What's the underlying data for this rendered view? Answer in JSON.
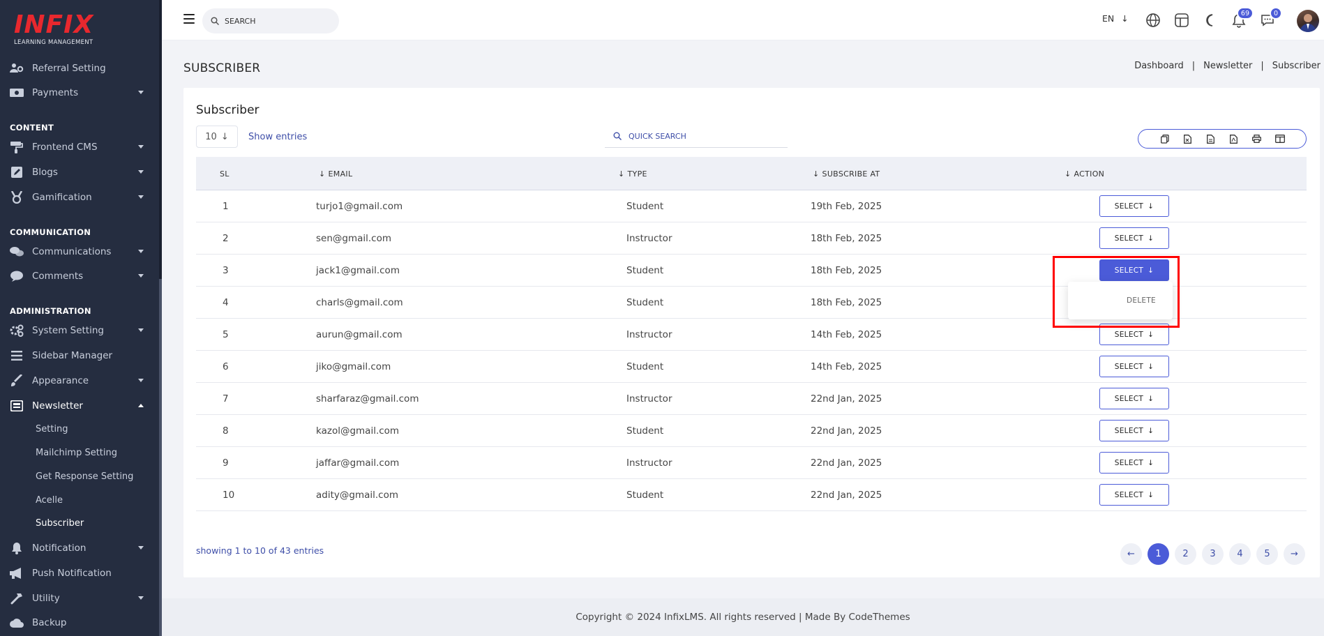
{
  "brand": {
    "logo_word": "INFIX",
    "logo_sub": "LEARNING MANAGEMENT"
  },
  "sidebar": {
    "items_top": [
      {
        "label": "Referral Setting",
        "icon": "users-gear-icon"
      },
      {
        "label": "Payments",
        "icon": "money-icon"
      }
    ],
    "section_content": "CONTENT",
    "items_content": [
      {
        "label": "Frontend CMS",
        "icon": "paint-roller-icon"
      },
      {
        "label": "Blogs",
        "icon": "edit-icon"
      },
      {
        "label": "Gamification",
        "icon": "medal-icon"
      }
    ],
    "section_communication": "COMMUNICATION",
    "items_communication": [
      {
        "label": "Communications",
        "icon": "chat-icon"
      },
      {
        "label": "Comments",
        "icon": "comment-icon"
      }
    ],
    "section_administration": "ADMINISTRATION",
    "items_admin": [
      {
        "label": "System Setting",
        "icon": "gears-icon"
      },
      {
        "label": "Sidebar Manager",
        "icon": "list-icon"
      },
      {
        "label": "Appearance",
        "icon": "brush-icon"
      },
      {
        "label": "Newsletter",
        "icon": "newspaper-icon"
      }
    ],
    "newsletter_sub": [
      "Setting",
      "Mailchimp Setting",
      "Get Response Setting",
      "Acelle",
      "Subscriber"
    ],
    "items_bottom": [
      {
        "label": "Notification",
        "icon": "bell-icon"
      },
      {
        "label": "Push Notification",
        "icon": "megaphone-icon"
      },
      {
        "label": "Utility",
        "icon": "hammer-icon"
      },
      {
        "label": "Backup",
        "icon": "cloud-icon"
      }
    ]
  },
  "topbar": {
    "search_placeholder": "SEARCH",
    "language": "EN",
    "notifications_count": "69",
    "messages_count": "0"
  },
  "page": {
    "title": "SUBSCRIBER",
    "breadcrumb": [
      "Dashboard",
      "Newsletter",
      "Subscriber"
    ]
  },
  "card": {
    "title": "Subscriber",
    "entries_value": "10",
    "entries_label": "Show entries",
    "quick_search_placeholder": "QUICK SEARCH"
  },
  "table": {
    "headers": {
      "sl": "SL",
      "email": "EMAIL",
      "type": "TYPE",
      "subscribe_at": "SUBSCRIBE AT",
      "action": "ACTION"
    },
    "select_label": "SELECT",
    "rows": [
      {
        "sl": "1",
        "email": "turjo1@gmail.com",
        "type": "Student",
        "date": "19th Feb, 2025"
      },
      {
        "sl": "2",
        "email": "sen@gmail.com",
        "type": "Instructor",
        "date": "18th Feb, 2025"
      },
      {
        "sl": "3",
        "email": "jack1@gmail.com",
        "type": "Student",
        "date": "18th Feb, 2025"
      },
      {
        "sl": "4",
        "email": "charls@gmail.com",
        "type": "Student",
        "date": "18th Feb, 2025"
      },
      {
        "sl": "5",
        "email": "aurun@gmail.com",
        "type": "Instructor",
        "date": "14th Feb, 2025"
      },
      {
        "sl": "6",
        "email": "jiko@gmail.com",
        "type": "Student",
        "date": "14th Feb, 2025"
      },
      {
        "sl": "7",
        "email": "sharfaraz@gmail.com",
        "type": "Instructor",
        "date": "22nd Jan, 2025"
      },
      {
        "sl": "8",
        "email": "kazol@gmail.com",
        "type": "Student",
        "date": "22nd Jan, 2025"
      },
      {
        "sl": "9",
        "email": "jaffar@gmail.com",
        "type": "Instructor",
        "date": "22nd Jan, 2025"
      },
      {
        "sl": "10",
        "email": "adity@gmail.com",
        "type": "Student",
        "date": "22nd Jan, 2025"
      }
    ],
    "open_row_index": 2,
    "dropdown_item": "DELETE"
  },
  "summary": "showing 1 to 10 of 43 entries",
  "pagination": [
    "1",
    "2",
    "3",
    "4",
    "5"
  ],
  "footer": "Copyright © 2024 InfixLMS. All rights reserved | Made By CodeThemes",
  "colors": {
    "accent": "#4b5bd8",
    "sidebar": "#252d40",
    "brand_red": "#e8282e",
    "highlight": "#ff0000"
  }
}
